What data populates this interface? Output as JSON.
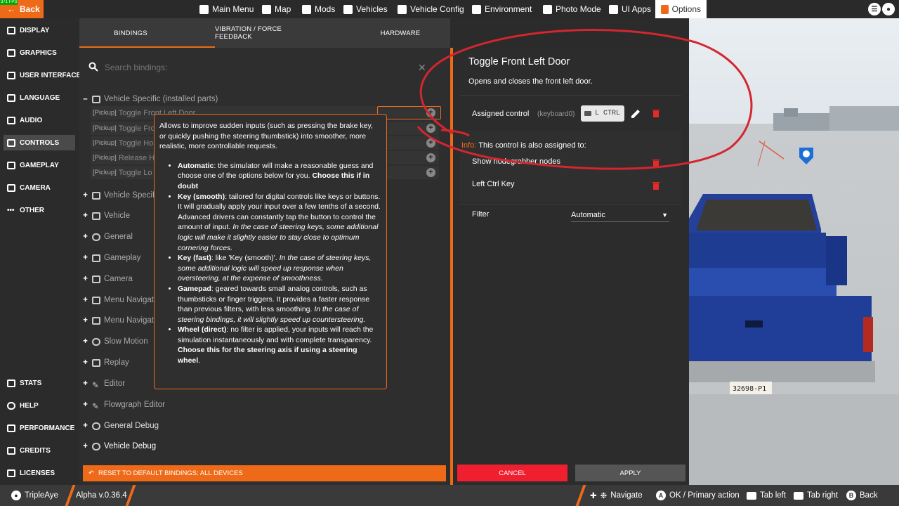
{
  "topbar": {
    "back_label": "Back",
    "fps_label": "371 FPS",
    "nav": [
      {
        "label": "Main Menu",
        "icon": "menu-icon"
      },
      {
        "label": "Map",
        "icon": "map-icon"
      },
      {
        "label": "Mods",
        "icon": "puzzle-icon"
      },
      {
        "label": "Vehicles",
        "icon": "car-icon"
      },
      {
        "label": "Vehicle Config",
        "icon": "wrench-car-icon"
      },
      {
        "label": "Environment",
        "icon": "weather-icon"
      },
      {
        "label": "Photo Mode",
        "icon": "camera-icon"
      },
      {
        "label": "UI Apps",
        "icon": "apps-icon"
      },
      {
        "label": "Options",
        "icon": "sliders-icon",
        "active": true
      }
    ]
  },
  "sidebar": {
    "items": [
      {
        "label": "DISPLAY"
      },
      {
        "label": "GRAPHICS"
      },
      {
        "label": "USER INTERFACE"
      },
      {
        "label": "LANGUAGE"
      },
      {
        "label": "AUDIO"
      },
      {
        "label": "CONTROLS",
        "active": true
      },
      {
        "label": "GAMEPLAY"
      },
      {
        "label": "CAMERA"
      },
      {
        "label": "OTHER"
      }
    ],
    "bottom_items": [
      {
        "label": "STATS"
      },
      {
        "label": "HELP"
      },
      {
        "label": "PERFORMANCE"
      },
      {
        "label": "CREDITS"
      },
      {
        "label": "LICENSES"
      }
    ]
  },
  "tabs": {
    "bindings": "BINDINGS",
    "vibration": "VIBRATION / FORCE FEEDBACK",
    "hardware": "HARDWARE"
  },
  "search": {
    "placeholder": "Search bindings:"
  },
  "tree": {
    "vehicle_specific_installed": "Vehicle Specific (installed parts)",
    "sub_items": [
      {
        "tag": "[Pickup]",
        "label": "Toggle Front Left Door"
      },
      {
        "tag": "[Pickup]",
        "label": "Toggle Fro"
      },
      {
        "tag": "[Pickup]",
        "label": "Toggle Ho"
      },
      {
        "tag": "[Pickup]",
        "label": "Release H"
      },
      {
        "tag": "[Pickup]",
        "label": "Toggle Lo"
      }
    ],
    "categories": [
      "Vehicle Specific",
      "Vehicle",
      "General",
      "Gameplay",
      "Camera",
      "Menu Navigation",
      "Menu Navigation",
      "Slow Motion",
      "Replay",
      "Editor",
      "Flowgraph Editor",
      "General Debug",
      "Vehicle Debug"
    ],
    "reset_label": "RESET TO DEFAULT BINDINGS: ALL DEVICES"
  },
  "tooltip": {
    "intro": "Allows to improve sudden inputs (such as pressing the brake key, or quickly pushing the steering thumbstick) into smoother, more realistic, more controllable requests.",
    "auto_title": "Automatic",
    "auto_text": ": the simulator will make a reasonable guess and choose one of the options below for you. ",
    "auto_bold": "Choose this if in doubt",
    "smooth_title": "Key (smooth)",
    "smooth_text": ": tailored for digital controls like keys or buttons. It will gradually apply your input over a few tenths of a second. Advanced drivers can constantly tap the button to control the amount of input. ",
    "smooth_italic": "In the case of steering keys, some additional logic will make it slightly easier to stay close to optimum cornering forces.",
    "fast_title": "Key (fast)",
    "fast_text": ": like 'Key (smooth)'. ",
    "fast_italic": "In the case of steering keys, some additional logic will speed up response when oversteering, at the expense of smoothness.",
    "gamepad_title": "Gamepad",
    "gamepad_text": ": geared towards small analog controls, such as thumbsticks or finger triggers. It provides a faster response than previous filters, with less smoothing. ",
    "gamepad_italic": "In the case of steering bindings, it will slightly speed up countersteering.",
    "wheel_title": "Wheel (direct)",
    "wheel_text": ": no filter is applied, your inputs will reach the simulation instantaneously and with complete transparency. ",
    "wheel_bold": "Choose this for the steering axis if using a steering wheel",
    "wheel_end": "."
  },
  "detail": {
    "title": "Toggle Front Left Door",
    "description": "Opens and closes the front left door.",
    "assigned_label": "Assigned control",
    "assigned_device": "(keyboard0)",
    "assigned_key": "L  CTRL",
    "info_label": "Info:",
    "info_text": " This control is also assigned to:",
    "conflicts": [
      "Show nodegrabber nodes",
      "Left Ctrl Key"
    ],
    "filter_label": "Filter",
    "filter_value": "Automatic",
    "cancel_label": "CANCEL",
    "apply_label": "APPLY"
  },
  "scene": {
    "plate": "32698-P1"
  },
  "bottombar": {
    "user": "TripleAye",
    "version": "Alpha v.0.36.4",
    "navigate": "Navigate",
    "ok": "OK / Primary action",
    "ok_key": "A",
    "tab_left": "Tab left",
    "tab_right": "Tab right",
    "back": "Back",
    "back_key": "B"
  },
  "colors": {
    "accent": "#ee6a18",
    "danger": "#ef1f2f",
    "annotation": "#d3262f"
  }
}
